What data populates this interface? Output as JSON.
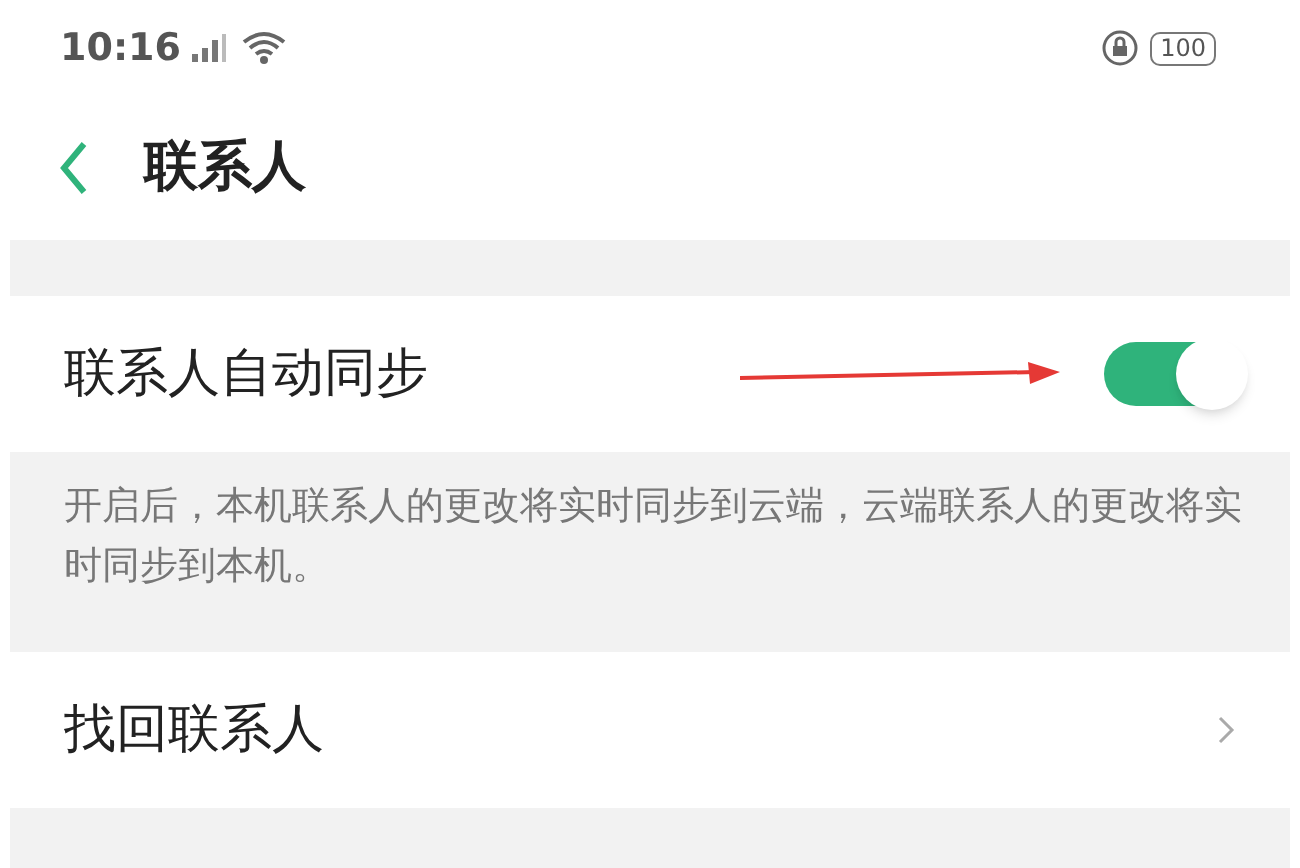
{
  "status_bar": {
    "time": "10:16",
    "battery": "100"
  },
  "header": {
    "title": "联系人"
  },
  "settings": [
    {
      "kind": "toggle",
      "label": "联系人自动同步",
      "on": true,
      "description": "开启后，本机联系人的更改将实时同步到云端，云端联系人的更改将实时同步到本机。"
    },
    {
      "kind": "link",
      "label": "找回联系人"
    }
  ]
}
